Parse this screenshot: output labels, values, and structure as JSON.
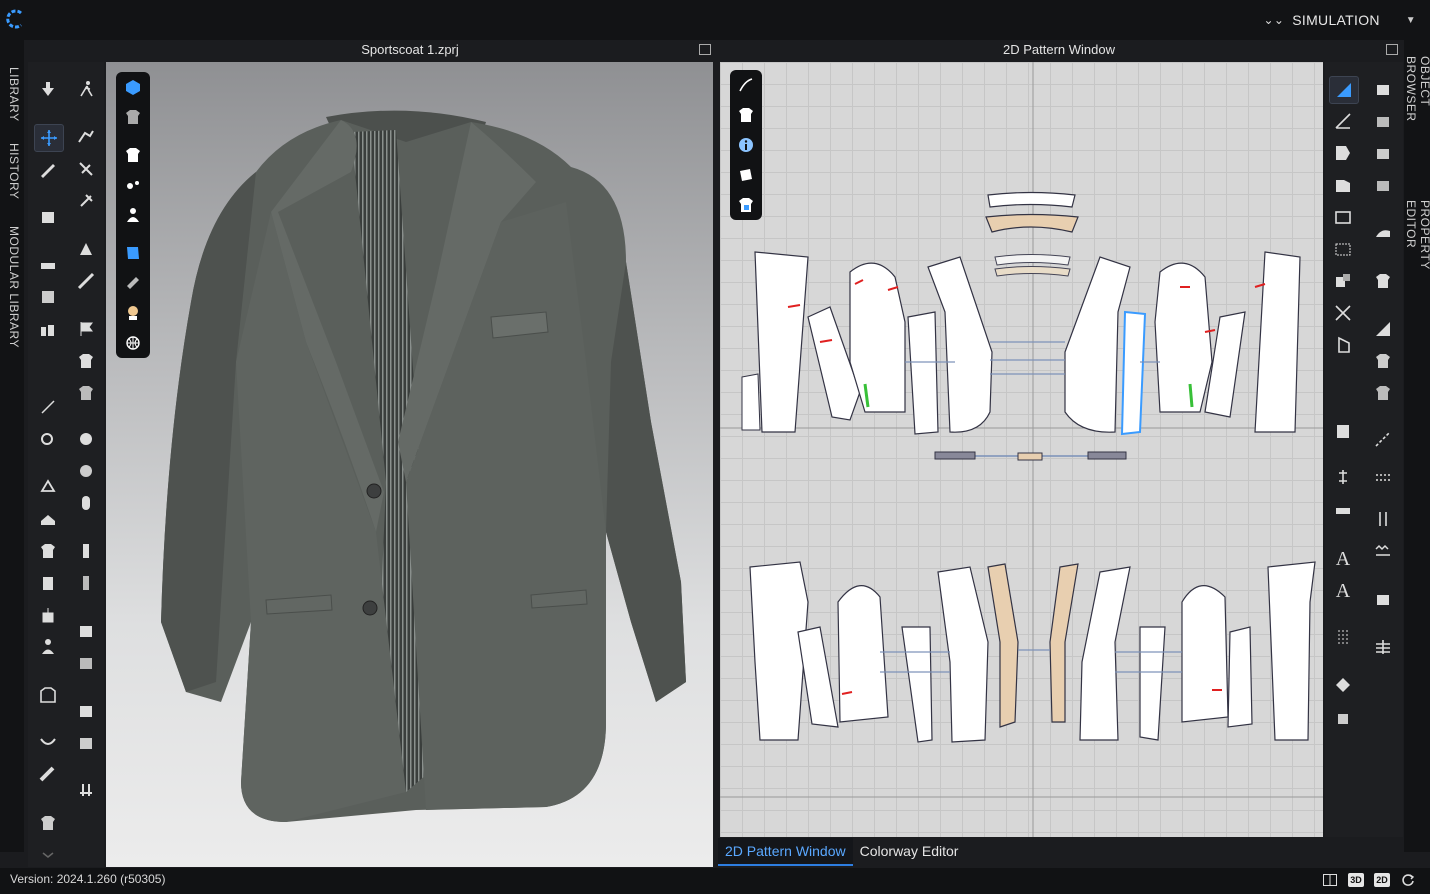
{
  "app": {
    "logo": "clo-logo-icon"
  },
  "topbar": {
    "simulation_label": "SIMULATION",
    "simulation_icon": "double-chevron-down-icon",
    "dropdown_icon": "caret-down-icon"
  },
  "left_tabs": [
    "LIBRARY",
    "HISTORY",
    "MODULAR LIBRARY"
  ],
  "right_tabs": [
    "OBJECT BROWSER",
    "PROPERTY EDITOR"
  ],
  "view3d": {
    "title": "Sportscoat 1.zprj"
  },
  "view2d": {
    "title": "2D Pattern Window"
  },
  "bottom_tabs": [
    {
      "label": "2D Pattern Window",
      "active": true
    },
    {
      "label": "Colorway Editor",
      "active": false
    }
  ],
  "status": {
    "version": "Version: 2024.1.260 (r50305)",
    "view_buttons": [
      "3D",
      "2D"
    ]
  },
  "colors": {
    "accent": "#2d7de0",
    "fabric": "#5c605c",
    "pattern_fill": "#ffffff",
    "pattern_tan": "#e8cfb0",
    "seam_red": "#e02020",
    "seam_green": "#38c038"
  }
}
